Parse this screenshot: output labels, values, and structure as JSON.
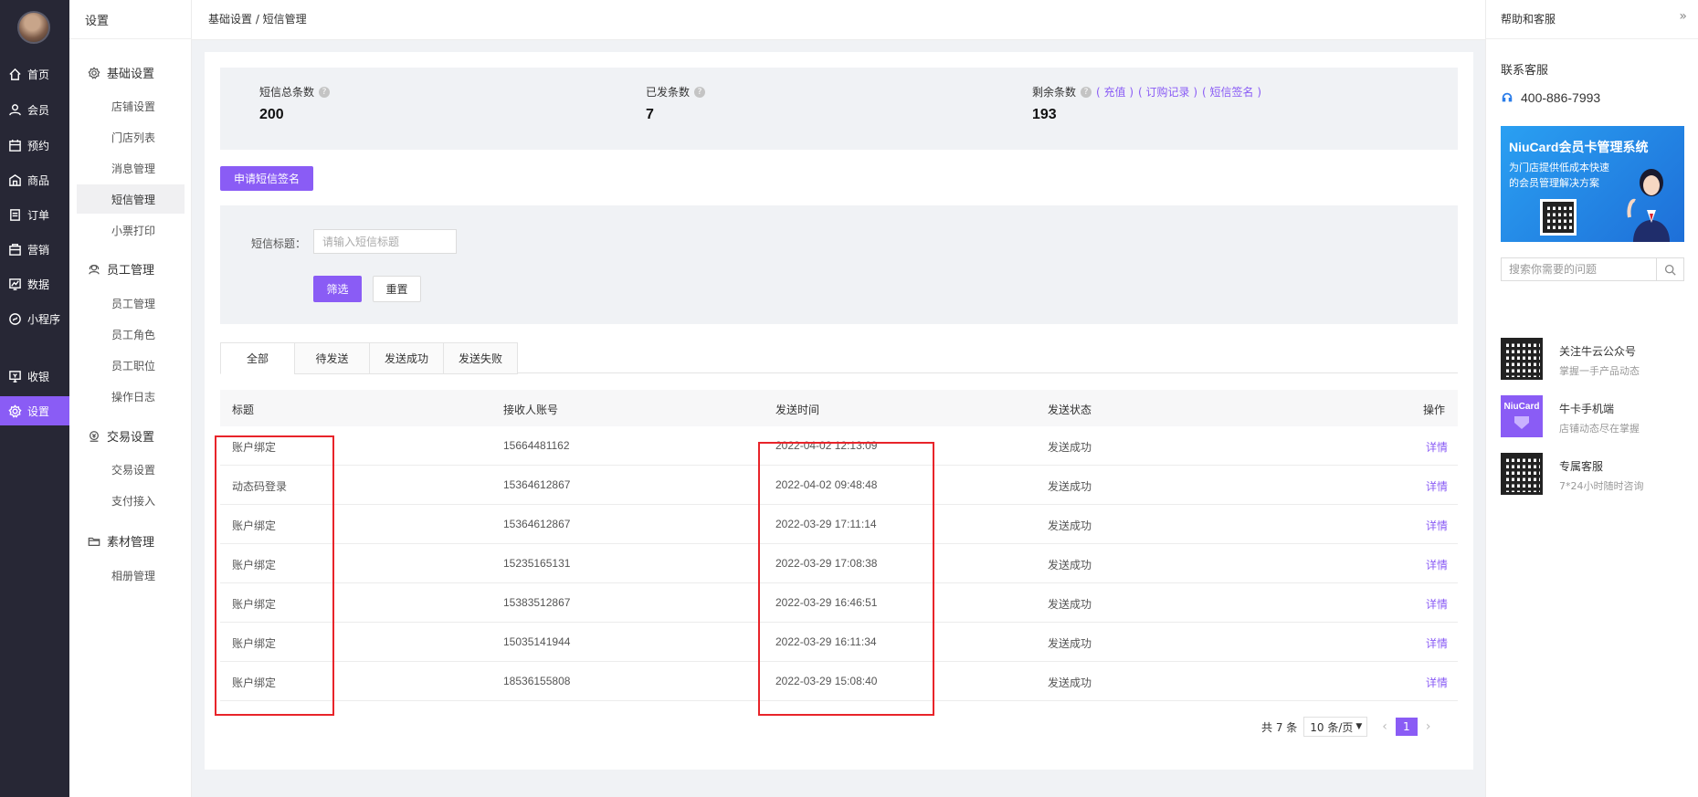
{
  "nav": {
    "items": [
      {
        "label": "首页",
        "icon": "home-icon"
      },
      {
        "label": "会员",
        "icon": "member-icon"
      },
      {
        "label": "预约",
        "icon": "calendar-icon"
      },
      {
        "label": "商品",
        "icon": "goods-icon"
      },
      {
        "label": "订单",
        "icon": "order-icon"
      },
      {
        "label": "营销",
        "icon": "marketing-icon"
      },
      {
        "label": "数据",
        "icon": "chart-icon"
      },
      {
        "label": "小程序",
        "icon": "miniapp-icon"
      },
      {
        "label": "收银",
        "icon": "cashier-icon"
      },
      {
        "label": "设置",
        "icon": "gear-icon"
      }
    ],
    "active_color": "#8a5cf5"
  },
  "sidebar": {
    "title": "设置",
    "groups": [
      {
        "label": "基础设置",
        "icon": "gear-icon",
        "items": [
          "店铺设置",
          "门店列表",
          "消息管理",
          "短信管理",
          "小票打印"
        ]
      },
      {
        "label": "员工管理",
        "icon": "staff-icon",
        "items": [
          "员工管理",
          "员工角色",
          "员工职位",
          "操作日志"
        ]
      },
      {
        "label": "交易设置",
        "icon": "trade-icon",
        "items": [
          "交易设置",
          "支付接入"
        ]
      },
      {
        "label": "素材管理",
        "icon": "folder-icon",
        "items": [
          "相册管理"
        ]
      }
    ],
    "active_item": "短信管理"
  },
  "breadcrumb": "基础设置 / 短信管理",
  "stats": {
    "total_label": "短信总条数",
    "total_value": "200",
    "sent_label": "已发条数",
    "sent_value": "7",
    "remain_label": "剩余条数",
    "remain_value": "193",
    "links": [
      "( 充值 )",
      "( 订购记录 )",
      "( 短信签名 )"
    ]
  },
  "apply_button": "申请短信签名",
  "filter": {
    "title_label": "短信标题：",
    "title_placeholder": "请输入短信标题",
    "filter_button": "筛选",
    "reset_button": "重置"
  },
  "tabs": [
    "全部",
    "待发送",
    "发送成功",
    "发送失败"
  ],
  "table": {
    "headers": [
      "标题",
      "接收人账号",
      "发送时间",
      "发送状态",
      "操作"
    ],
    "rows": [
      {
        "title": "账户绑定",
        "account": "15664481162",
        "time": "2022-04-02 12:13:09",
        "status": "发送成功",
        "action": "详情"
      },
      {
        "title": "动态码登录",
        "account": "15364612867",
        "time": "2022-04-02 09:48:48",
        "status": "发送成功",
        "action": "详情"
      },
      {
        "title": "账户绑定",
        "account": "15364612867",
        "time": "2022-03-29 17:11:14",
        "status": "发送成功",
        "action": "详情"
      },
      {
        "title": "账户绑定",
        "account": "15235165131",
        "time": "2022-03-29 17:08:38",
        "status": "发送成功",
        "action": "详情"
      },
      {
        "title": "账户绑定",
        "account": "15383512867",
        "time": "2022-03-29 16:46:51",
        "status": "发送成功",
        "action": "详情"
      },
      {
        "title": "账户绑定",
        "account": "15035141944",
        "time": "2022-03-29 16:11:34",
        "status": "发送成功",
        "action": "详情"
      },
      {
        "title": "账户绑定",
        "account": "18536155808",
        "time": "2022-03-29 15:08:40",
        "status": "发送成功",
        "action": "详情"
      }
    ]
  },
  "pagination": {
    "total": "共 7 条",
    "page_size": "10 条/页",
    "current_page": "1"
  },
  "help": {
    "title": "帮助和客服",
    "cs_title": "联系客服",
    "phone": "400-886-7993",
    "banner_title": "NiuCard会员卡管理系统",
    "banner_sub": "为门店提供低成本快速的会员管理解决方案",
    "search_placeholder": "搜索你需要的问题",
    "promos": [
      {
        "title": "关注牛云公众号",
        "sub": "掌握一手产品动态"
      },
      {
        "title": "牛卡手机端",
        "sub": "店铺动态尽在掌握",
        "thumb_text": "NiuCard"
      },
      {
        "title": "专属客服",
        "sub": "7*24小时随时咨询"
      }
    ]
  },
  "annotation_color": "#e8242a"
}
